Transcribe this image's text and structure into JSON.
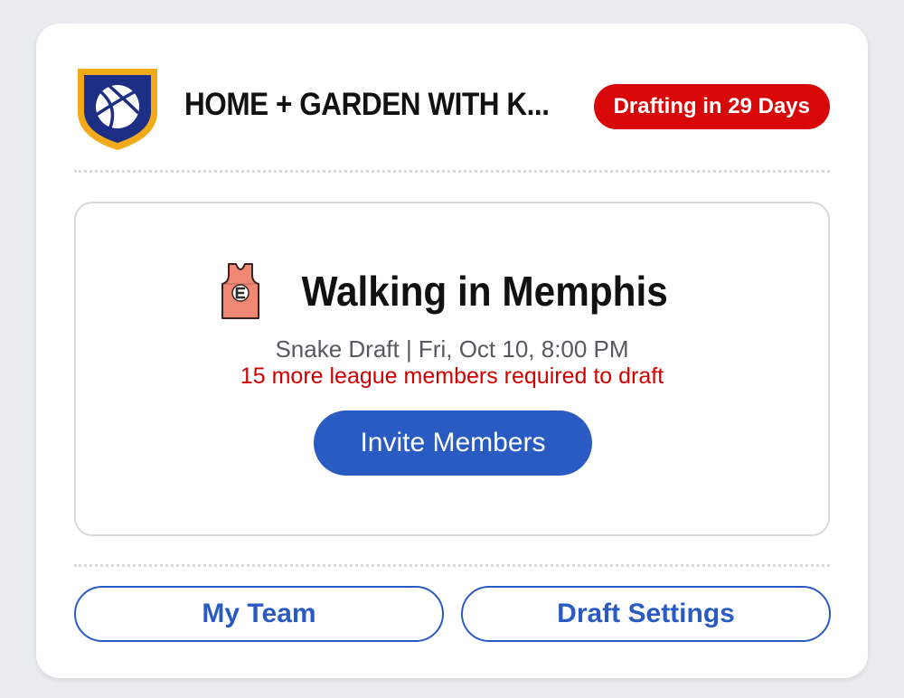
{
  "league": {
    "name": "HOME + GARDEN WITH K...",
    "logo_icon": "basketball-shield-icon",
    "draft_badge": "Drafting in 29 Days"
  },
  "team": {
    "icon": "jersey-icon",
    "name": "Walking in Memphis",
    "draft_info": "Snake Draft | Fri, Oct 10, 8:00 PM",
    "members_warning": "15 more league members required to draft",
    "invite_button": "Invite Members"
  },
  "actions": {
    "my_team": "My Team",
    "draft_settings": "Draft Settings"
  },
  "colors": {
    "accent_blue": "#2a5bc2",
    "badge_red": "#d80808",
    "warning_red": "#d00000",
    "logo_navy": "#1d2f84",
    "logo_gold": "#f2aa18",
    "jersey_salmon": "#f18873"
  }
}
